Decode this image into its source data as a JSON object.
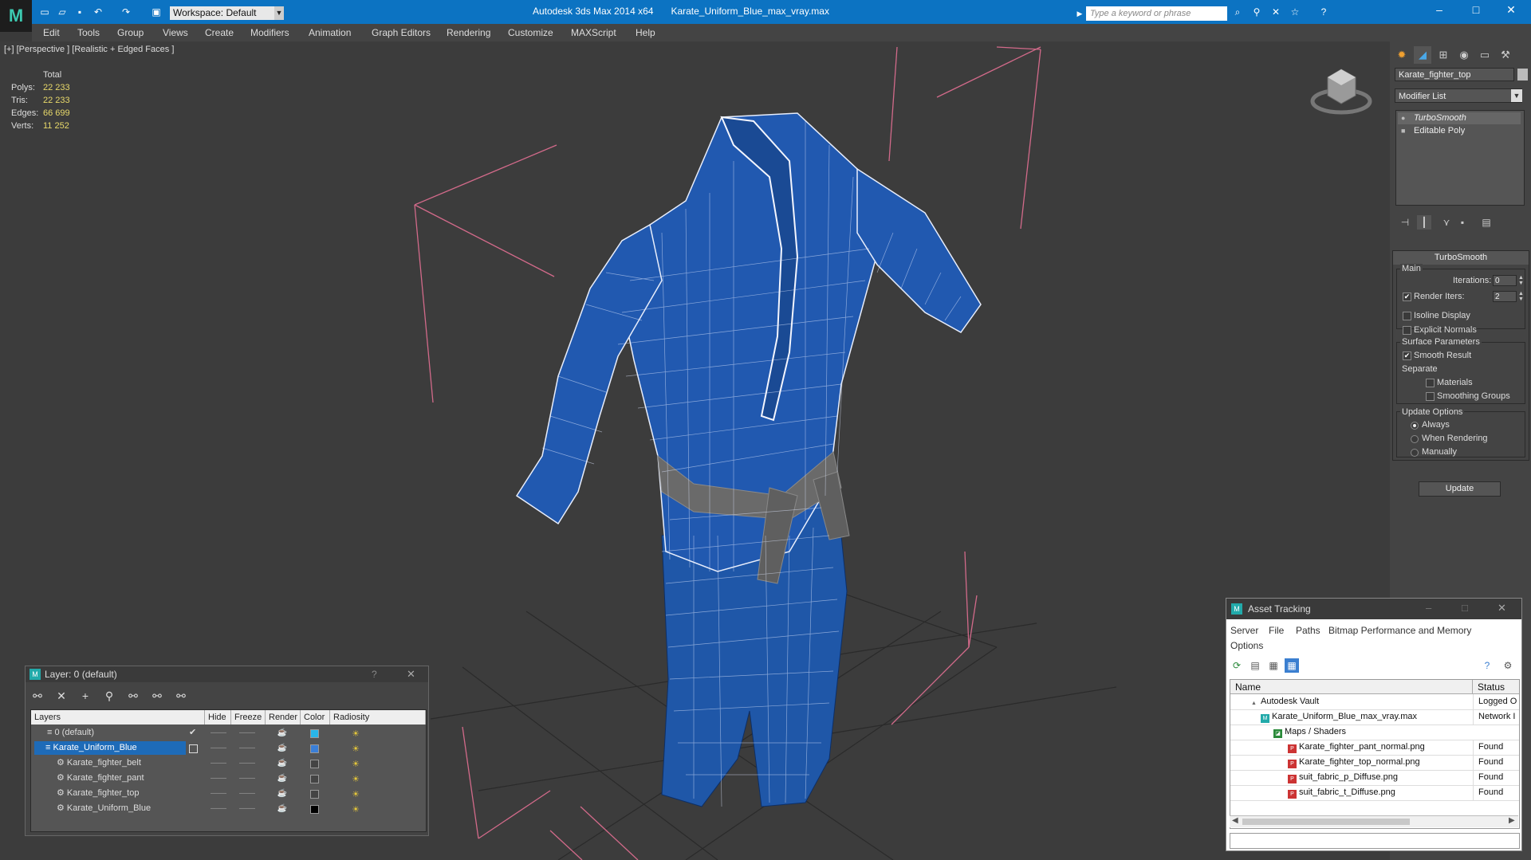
{
  "app": {
    "title": "Autodesk 3ds Max  2014 x64",
    "file": "Karate_Uniform_Blue_max_vray.max",
    "workspace": "Workspace: Default",
    "search_placeholder": "Type a keyword or phrase"
  },
  "menu": [
    "Edit",
    "Tools",
    "Group",
    "Views",
    "Create",
    "Modifiers",
    "Animation",
    "Graph Editors",
    "Rendering",
    "Customize",
    "MAXScript",
    "Help"
  ],
  "viewport": {
    "label": "[+] [Perspective ] [Realistic + Edged Faces ]",
    "stats": {
      "header": "Total",
      "rows": [
        {
          "label": "Polys:",
          "value": "22 233"
        },
        {
          "label": "Tris:",
          "value": "22 233"
        },
        {
          "label": "Edges:",
          "value": "66 699"
        },
        {
          "label": "Verts:",
          "value": "11 252"
        }
      ]
    }
  },
  "command_panel": {
    "object_name": "Karate_fighter_top",
    "modifier_list": "Modifier List",
    "stack": [
      "TurboSmooth",
      "Editable Poly"
    ],
    "turbosmooth": {
      "title": "TurboSmooth",
      "main": "Main",
      "iterations_label": "Iterations:",
      "iterations": "0",
      "render_iters_label": "Render Iters:",
      "render_iters": "2",
      "isoline": "Isoline Display",
      "explicit": "Explicit Normals",
      "surface": "Surface Parameters",
      "smooth_result": "Smooth Result",
      "separate": "Separate",
      "materials": "Materials",
      "smoothing_groups": "Smoothing Groups",
      "update_options": "Update Options",
      "always": "Always",
      "when_rendering": "When Rendering",
      "manually": "Manually",
      "update": "Update"
    }
  },
  "layer_dialog": {
    "title": "Layer: 0 (default)",
    "help": "?",
    "columns": [
      "Layers",
      "Hide",
      "Freeze",
      "Render",
      "Color",
      "Radiosity"
    ],
    "rows": [
      {
        "name": "0 (default)",
        "color": "#29b6e8"
      },
      {
        "name": "Karate_Uniform_Blue",
        "color": "#3a7fd8"
      },
      {
        "name": "Karate_fighter_belt",
        "color": "#444444"
      },
      {
        "name": "Karate_fighter_pant",
        "color": "#444444"
      },
      {
        "name": "Karate_fighter_top",
        "color": "#444444"
      },
      {
        "name": "Karate_Uniform_Blue",
        "color": "#000000"
      }
    ]
  },
  "asset_dialog": {
    "title": "Asset Tracking",
    "menu": [
      "Server",
      "File",
      "Paths",
      "Bitmap Performance and Memory",
      "Options"
    ],
    "columns": [
      "Name",
      "Status"
    ],
    "rows": [
      {
        "name": "Autodesk Vault",
        "status": "Logged O"
      },
      {
        "name": "Karate_Uniform_Blue_max_vray.max",
        "status": "Network I"
      },
      {
        "name": "Maps / Shaders",
        "status": ""
      },
      {
        "name": "Karate_fighter_pant_normal.png",
        "status": "Found"
      },
      {
        "name": "Karate_fighter_top_normal.png",
        "status": "Found"
      },
      {
        "name": "suit_fabric_p_Diffuse.png",
        "status": "Found"
      },
      {
        "name": "suit_fabric_t_Diffuse.png",
        "status": "Found"
      }
    ]
  },
  "colors": {
    "titlebar": "#0c73c2",
    "selection": "#1e6bb8",
    "mesh_blue": "#1f57a8",
    "bbox": "#d26a8a"
  }
}
